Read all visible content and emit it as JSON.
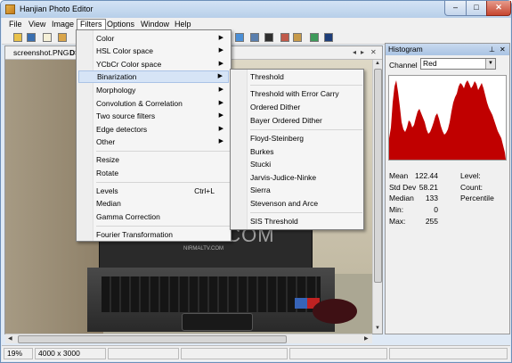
{
  "window": {
    "title": "Hanjian Photo Editor"
  },
  "title_buttons": {
    "minimize": "–",
    "maximize": "□",
    "close": "✕"
  },
  "menubar": [
    "File",
    "View",
    "Image",
    "Filters",
    "Options",
    "Window",
    "Help"
  ],
  "toolbar_icons": [
    "open-icon",
    "save-icon",
    "copy-icon",
    "paste-icon",
    "tool-icon",
    "tool-icon",
    "tool-icon",
    "tool-icon",
    "tool-icon",
    "tool-icon",
    "tool-icon",
    "tool-icon",
    "tool-icon",
    "tool-icon"
  ],
  "document": {
    "tabs": [
      "screenshot.PNG",
      "DS"
    ],
    "nav": {
      "left": "◂",
      "right": "▸",
      "close": "✕"
    },
    "watermark": "NIRMAL.COM",
    "watermark_sub": "NIRMALTV.COM"
  },
  "filters_menu": {
    "items": [
      {
        "label": "Color",
        "arrow": "▶"
      },
      {
        "label": "HSL Color space",
        "arrow": "▶"
      },
      {
        "label": "YCbCr Color space",
        "arrow": "▶"
      },
      {
        "label": "Binarization",
        "arrow": "▶"
      },
      {
        "label": "Morphology",
        "arrow": "▶"
      },
      {
        "label": "Convolution & Correlation",
        "arrow": "▶"
      },
      {
        "label": "Two source filters",
        "arrow": "▶"
      },
      {
        "label": "Edge detectors",
        "arrow": "▶"
      },
      {
        "label": "Other",
        "arrow": "▶"
      },
      {
        "label": "Resize"
      },
      {
        "label": "Rotate"
      },
      {
        "label": "Levels",
        "shortcut": "Ctrl+L"
      },
      {
        "label": "Median"
      },
      {
        "label": "Gamma Correction"
      },
      {
        "label": "Fourier Transformation"
      }
    ]
  },
  "binarization_menu": {
    "items": [
      "Threshold",
      "Threshold with Error Carry",
      "Ordered Dither",
      "Bayer Ordered Dither",
      "Floyd-Steinberg",
      "Burkes",
      "Stucki",
      "Jarvis-Judice-Ninke",
      "Sierra",
      "Stevenson and Arce",
      "SIS Threshold"
    ]
  },
  "histogram": {
    "title": "Histogram",
    "pin": "📌",
    "close": "✕",
    "channel_label": "Channel",
    "channel_value": "Red",
    "select_arrow": "▼",
    "fill_color": "#c00000",
    "stats": {
      "mean_label": "Mean",
      "mean": "122.44",
      "std_label": "Std Dev",
      "std": "58.21",
      "median_label": "Median",
      "median": "133",
      "min_label": "Min:",
      "min": "0",
      "max_label": "Max:",
      "max": "255",
      "level_label": "Level:",
      "count_label": "Count:",
      "percentile_label": "Percentile"
    }
  },
  "statusbar": {
    "zoom": "19%",
    "size": "4000 x 3000"
  }
}
